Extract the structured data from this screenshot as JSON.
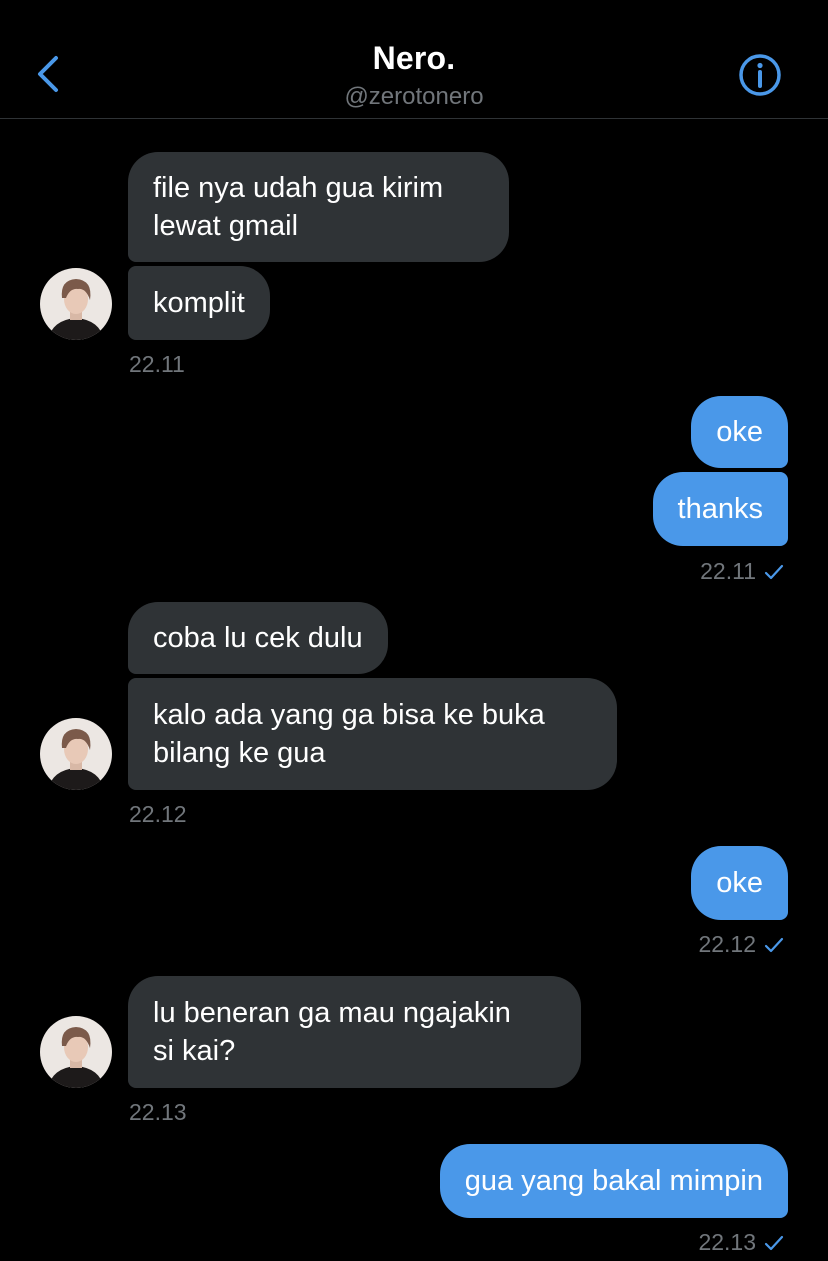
{
  "header": {
    "title": "Nero.",
    "handle": "@zerotonero",
    "back_icon": "chevron-left-icon",
    "info_icon": "info-circle-icon"
  },
  "colors": {
    "accent": "#4a98e9",
    "incoming_bubble": "#2f3336",
    "timestamp": "#71767b",
    "background": "#000000"
  },
  "messages": [
    {
      "direction": "in",
      "text": "file nya udah gua kirim lewat gmail",
      "lines": [
        "file nya udah gua kirim",
        "lewat gmail"
      ]
    },
    {
      "direction": "in",
      "text": "komplit"
    },
    {
      "direction": "in_time",
      "text": "22.11"
    },
    {
      "direction": "out",
      "text": "oke"
    },
    {
      "direction": "out",
      "text": "thanks"
    },
    {
      "direction": "out_time",
      "text": "22.11",
      "status": "sent-check-icon"
    },
    {
      "direction": "in",
      "text": "coba lu cek dulu"
    },
    {
      "direction": "in",
      "text": "kalo ada yang ga bisa ke buka bilang ke gua",
      "lines": [
        "kalo ada yang ga bisa ke buka",
        "bilang ke gua"
      ]
    },
    {
      "direction": "in_time",
      "text": "22.12"
    },
    {
      "direction": "out",
      "text": "oke"
    },
    {
      "direction": "out_time",
      "text": "22.12",
      "status": "sent-check-icon"
    },
    {
      "direction": "in",
      "text": "lu beneran ga mau ngajakin si kai?",
      "lines": [
        "lu beneran ga mau ngajakin",
        "si kai?"
      ]
    },
    {
      "direction": "in_time",
      "text": "22.13"
    },
    {
      "direction": "out",
      "text": "gua yang bakal mimpin"
    },
    {
      "direction": "out_time",
      "text": "22.13",
      "status": "sent-check-icon"
    }
  ]
}
